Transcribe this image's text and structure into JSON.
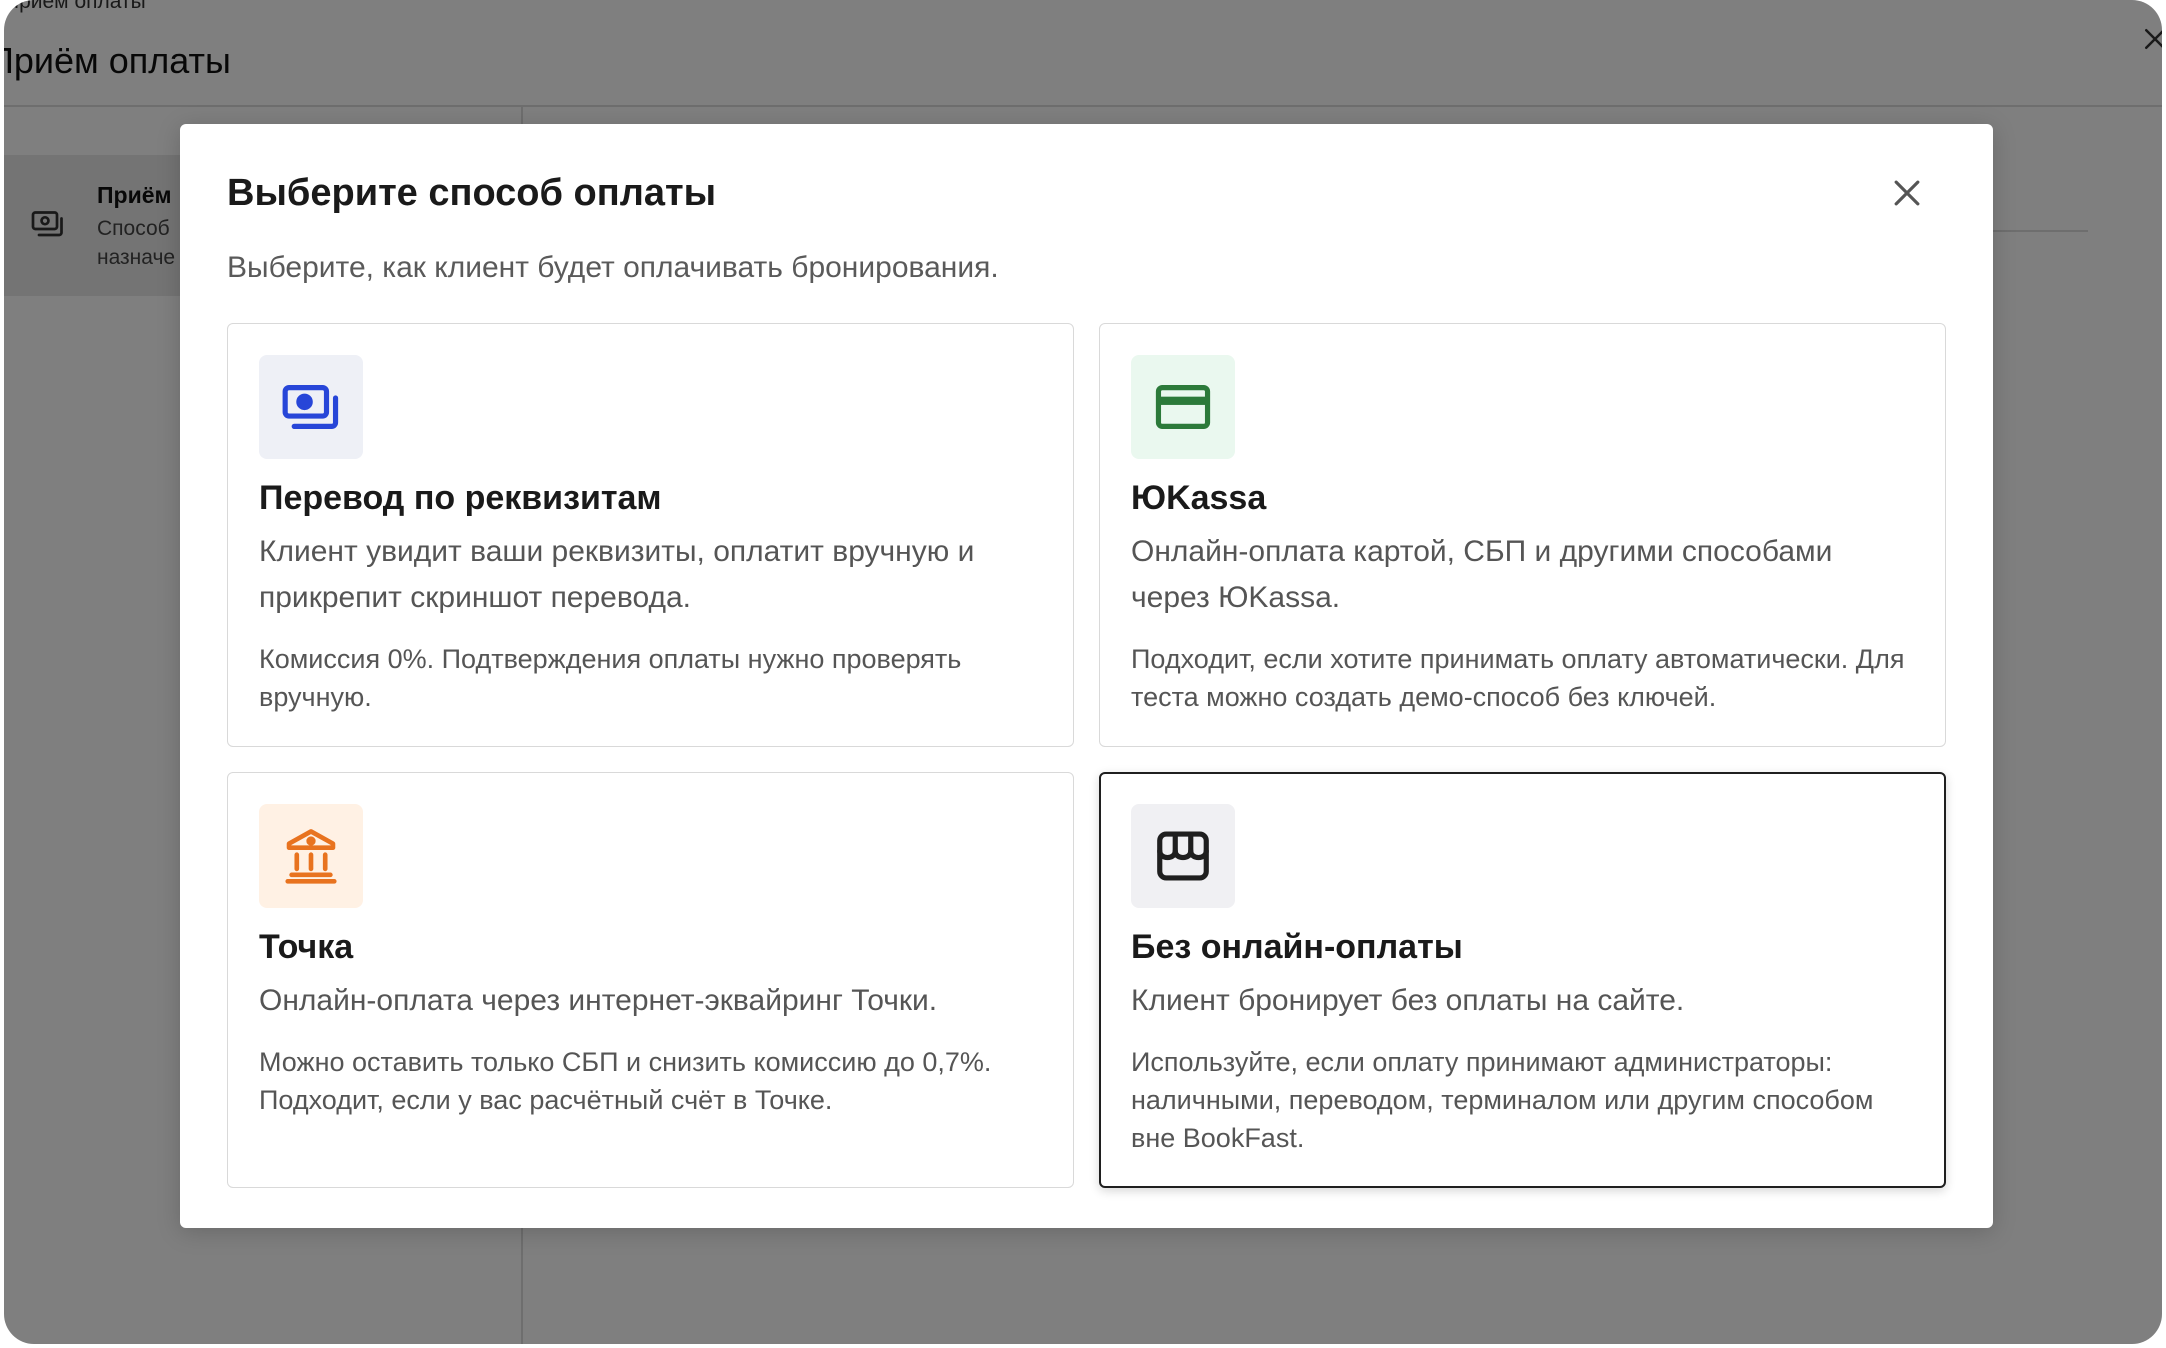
{
  "window": {
    "breadcrumb": "Приём оплаты",
    "title": "Приём оплаты",
    "close_icon": "close-icon"
  },
  "sidebar": {
    "items": [
      {
        "icon": "banknotes-icon",
        "title": "Приём",
        "line1": "Способ",
        "line2": "назначе",
        "selected": true
      }
    ]
  },
  "modal": {
    "title": "Выберите способ оплаты",
    "subtitle": "Выберите, как клиент будет оплачивать бронирования.",
    "close_icon": "close-icon",
    "options": [
      {
        "icon": "banknotes-icon",
        "title": "Перевод по реквизитам",
        "description": "Клиент увидит ваши реквизиты, оплатит вручную и прикрепит скриншот перевода.",
        "note": "Комиссия 0%. Подтверждения оплаты нужно проверять вручную.",
        "accent": "#2746d8",
        "icon_bg": "#eef0f6",
        "selected": false
      },
      {
        "icon": "credit-card-icon",
        "title": "ЮKassa",
        "description": "Онлайн-оплата картой, СБП и другими способами через ЮKassa.",
        "note": "Подходит, если хотите принимать оплату автоматически. Для теста можно создать демо-способ без ключей.",
        "accent": "#2c7a3a",
        "icon_bg": "#eaf8ef",
        "selected": false
      },
      {
        "icon": "bank-icon",
        "title": "Точка",
        "description": "Онлайн-оплата через интернет-эквайринг Точки.",
        "note": "Можно оставить только СБП и снизить комиссию до 0,7%. Подходит, если у вас расчётный счёт в Точке.",
        "accent": "#e8731f",
        "icon_bg": "#fff1e4",
        "selected": false
      },
      {
        "icon": "storefront-icon",
        "title": "Без онлайн-оплаты",
        "description": "Клиент бронирует без оплаты на сайте.",
        "note": "Используйте, если оплату принимают администраторы: наличными, переводом, терминалом или другим способом вне BookFast.",
        "accent": "#1f1f1f",
        "icon_bg": "#f0f0f3",
        "selected": true
      }
    ]
  },
  "colors": {
    "selected_border": "#1f1f1f",
    "card_border": "#d9d9d9",
    "overlay": "#000000"
  }
}
